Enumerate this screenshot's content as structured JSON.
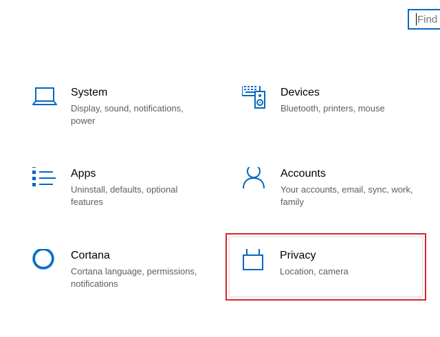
{
  "search": {
    "placeholder": "Find"
  },
  "tiles": [
    {
      "id": "system",
      "title": "System",
      "description": "Display, sound, notifications, power",
      "icon": "laptop-icon"
    },
    {
      "id": "devices",
      "title": "Devices",
      "description": "Bluetooth, printers, mouse",
      "icon": "devices-icon"
    },
    {
      "id": "apps",
      "title": "Apps",
      "description": "Uninstall, defaults, optional features",
      "icon": "apps-list-icon"
    },
    {
      "id": "accounts",
      "title": "Accounts",
      "description": "Your accounts, email, sync, work, family",
      "icon": "person-icon"
    },
    {
      "id": "cortana",
      "title": "Cortana",
      "description": "Cortana language, permissions, notifications",
      "icon": "cortana-circle-icon"
    },
    {
      "id": "privacy",
      "title": "Privacy",
      "description": "Location, camera",
      "icon": "lock-icon"
    }
  ],
  "colors": {
    "accent": "#0067c0",
    "highlight": "#d9222a",
    "description_text": "#5d5d5d"
  }
}
